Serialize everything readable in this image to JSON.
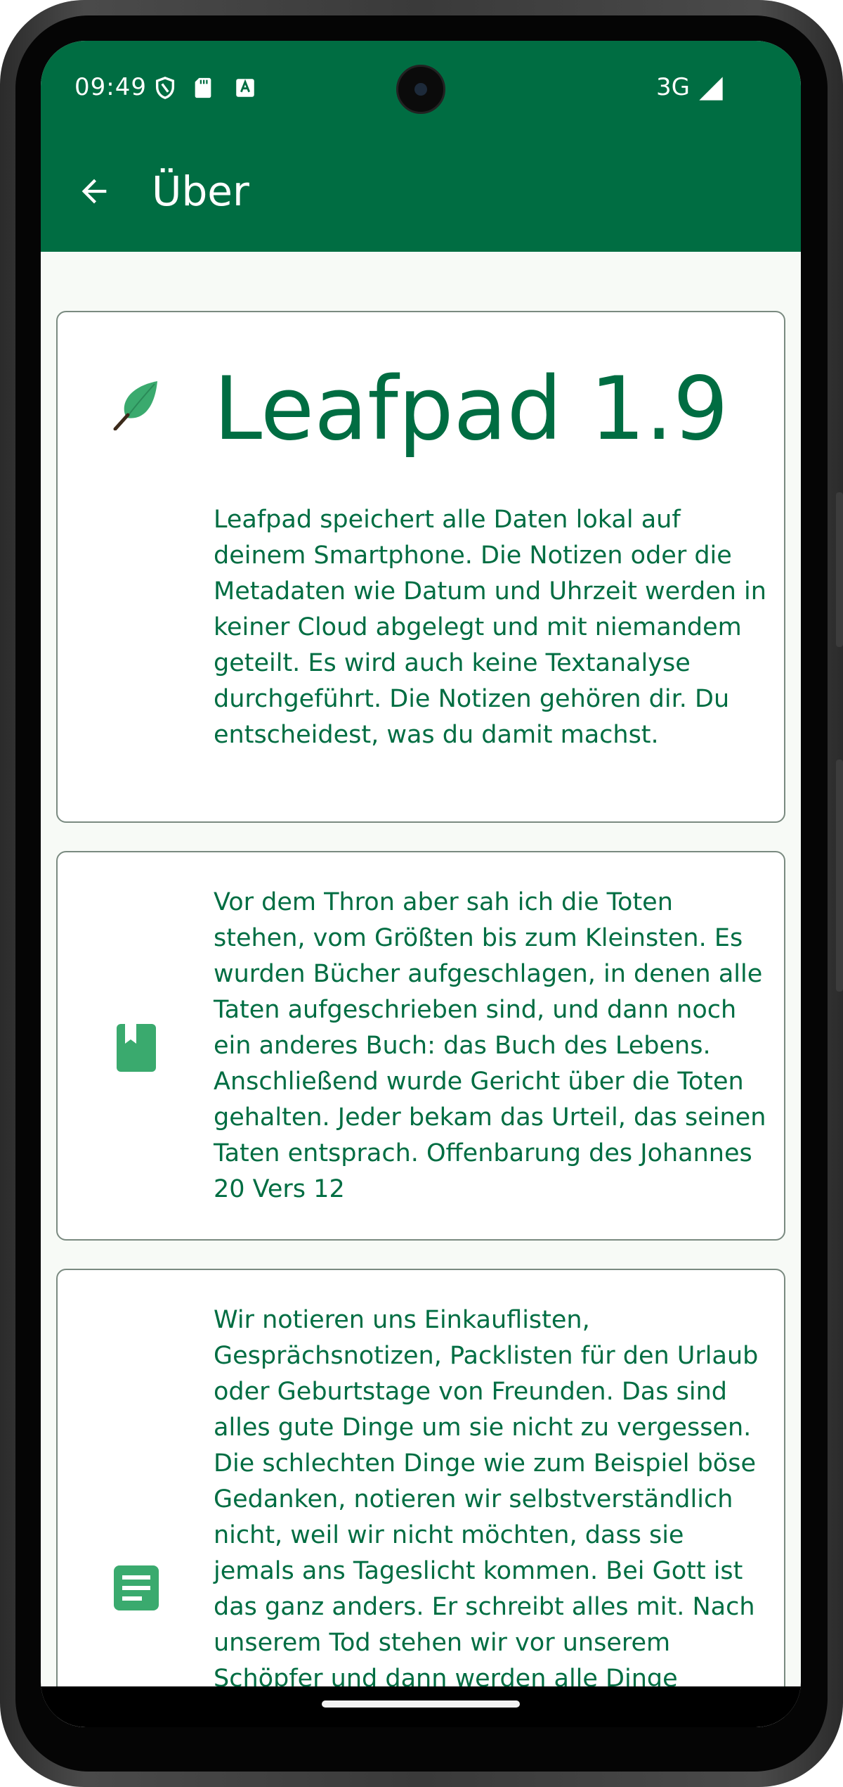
{
  "status_bar": {
    "time": "09:49",
    "network": "3G",
    "icons": [
      "shield-icon",
      "sd-card-icon",
      "keyboard-a-icon",
      "signal-icon"
    ]
  },
  "app_bar": {
    "title": "Über",
    "back_icon": "arrow-left-icon"
  },
  "cards": [
    {
      "icon": "leaf-icon",
      "heading": "Leafpad 1.9",
      "text": "Leafpad speichert alle Daten lokal auf deinem Smartphone. Die Notizen oder die Metadaten wie Datum und Uhrzeit werden in keiner Cloud abgelegt und mit niemandem geteilt. Es wird auch keine Textanalyse durchgeführt. Die Notizen gehören dir. Du entscheidest, was du damit machst."
    },
    {
      "icon": "book-icon",
      "text": "Vor dem Thron aber sah ich die Toten stehen, vom Größten bis zum Kleinsten. Es wurden Bücher aufgeschlagen, in denen alle Taten aufgeschrieben sind, und dann noch ein anderes Buch: das Buch des Lebens. Anschließend wurde Gericht über die Toten gehalten. Jeder bekam das Urteil, das seinen Taten entsprach. Offenbarung des Johannes 20 Vers 12"
    },
    {
      "icon": "note-icon",
      "text": "Wir notieren uns Einkauflisten, Gesprächsnotizen, Packlisten für den Urlaub oder Geburtstage von Freunden. Das sind alles gute Dinge um sie nicht zu vergessen. Die schlechten Dinge wie zum Beispiel böse Gedanken, notieren wir selbstverständlich nicht, weil wir nicht möchten, dass sie jemals ans Tageslicht kommen. Bei Gott ist das ganz anders. Er schreibt alles mit. Nach unserem Tod stehen wir vor unserem Schöpfer und dann werden alle Dinge offenbar, die"
    }
  ],
  "colors": {
    "primary": "#006d42",
    "icon_green": "#3aaa6e",
    "background": "#f7faf6",
    "card_border": "#7a8a80"
  }
}
